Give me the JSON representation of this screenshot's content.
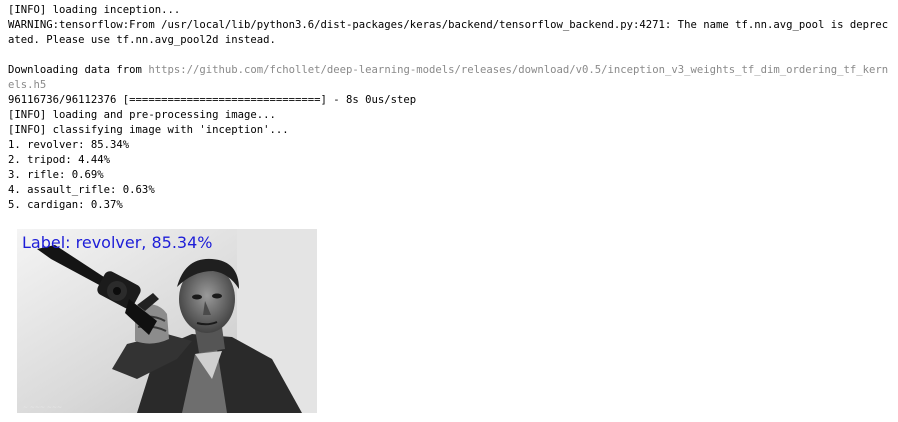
{
  "console": {
    "lines": [
      "[INFO] loading inception...",
      "WARNING:tensorflow:From /usr/local/lib/python3.6/dist-packages/keras/backend/tensorflow_backend.py:4271: The name tf.nn.avg_pool is deprecated. Please use tf.nn.avg_pool2d instead.",
      "",
      "Downloading data from ",
      "96116736/96112376 [==============================] - 8s 0us/step",
      "[INFO] loading and pre-processing image...",
      "[INFO] classifying image with 'inception'...",
      "1. revolver: 85.34%",
      "2. tripod: 4.44%",
      "3. rifle: 0.69%",
      "4. assault_rifle: 0.63%",
      "5. cardigan: 0.37%"
    ],
    "download_url": "https://github.com/fchollet/deep-learning-models/releases/download/v0.5/inception_v3_weights_tf_dim_ordering_tf_kernels.h5"
  },
  "output_image": {
    "label_text": "Label: revolver, 85.34%",
    "label_color": "#1d1dd8"
  }
}
